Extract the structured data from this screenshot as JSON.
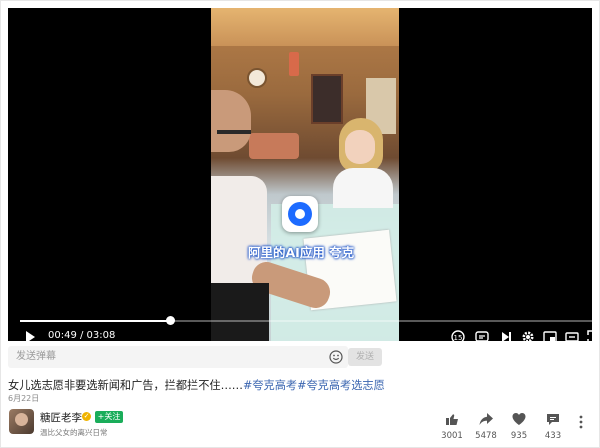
{
  "player": {
    "caption": "阿里的AI应用  夸克",
    "time_current": "00:49",
    "time_total": "03:08",
    "time_display": "00:49 / 03:08",
    "progress_fraction": 0.26,
    "control_icons": [
      "play-icon",
      "replay-speed-icon",
      "danmaku-icon",
      "next-icon",
      "settings-icon",
      "pip-icon",
      "widescreen-icon",
      "fullscreen-icon"
    ]
  },
  "danmaku": {
    "placeholder": "发送弹幕",
    "send_label": "发送"
  },
  "video_info": {
    "title_text": "女儿选志愿非要选新闻和广告，拦都拦不住……",
    "tag_1": "#夸克高考",
    "tag_2": "#夸克高考选志愿",
    "date": "6月22日"
  },
  "author": {
    "name": "糖匠老李",
    "follow_label": "+关注",
    "subtitle": "温比父女的离兴日常"
  },
  "stats": {
    "likes": "3001",
    "shares": "5478",
    "favorites": "935",
    "comments": "433"
  },
  "colors": {
    "accent_follow": "#1aad5a",
    "tag_link": "#3a65b0",
    "player_bg": "#000000"
  }
}
